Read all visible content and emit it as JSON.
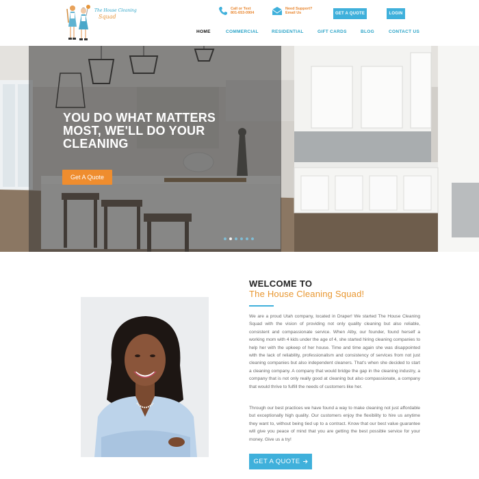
{
  "brand": {
    "logo_line1": "The House Cleaning",
    "logo_line2": "Squad"
  },
  "header": {
    "phone_label": "Call or Text",
    "phone_number": "801-653-0904",
    "support_label": "Need Support?",
    "support_text": "Email Us",
    "quote_button": "GET A QUOTE",
    "login_button": "LOGIN"
  },
  "nav": {
    "items": [
      {
        "label": "HOME",
        "active": true
      },
      {
        "label": "COMMERCIAL",
        "active": false
      },
      {
        "label": "RESIDENTIAL",
        "active": false
      },
      {
        "label": "GIFT CARDS",
        "active": false
      },
      {
        "label": "BLOG",
        "active": false
      },
      {
        "label": "CONTACT US",
        "active": false
      }
    ]
  },
  "hero": {
    "headline": "YOU DO WHAT MATTERS MOST, WE'LL DO YOUR CLEANING",
    "button": "Get A Quote",
    "slide_count": 6,
    "active_slide": 2
  },
  "welcome": {
    "heading": "WELCOME TO",
    "subheading": "The House Cleaning Squad!",
    "paragraph1": "We are a proud Utah company, located in Draper! We started The House Cleaning Squad with the vision of providing not only quality cleaning but also reliable, consistent and compassionate service. When Alby, our founder, found herself a working mom with 4 kids under the age of 4, she started hiring cleaning companies to help her with the upkeep of her house. Time and time again she was disappointed with the lack of reliability, professionalism and consistency of services from not just cleaning companies but also independent cleaners. That's when she decided to start a cleaning company. A company that would bridge the gap in the cleaning industry, a company that is not only really good at cleaning but also compassionate, a company that would thrive to fulfill the needs of customers like her.",
    "paragraph2": "Through our best practices we have found a way to make cleaning not just affordable but exceptionally high quality. Our customers enjoy the flexibility to hire us anytime they want to, without being tied up to a contract. Know that our best value guarantee will give you peace of mind that you are getting the best possible service for your money. Give us a try!",
    "cta": "GET A QUOTE",
    "cta_icon": "arrow-right-icon"
  },
  "colors": {
    "accent_blue": "#3fb0db",
    "accent_orange": "#ef8d2e",
    "nav_blue": "#2aa3c7"
  }
}
